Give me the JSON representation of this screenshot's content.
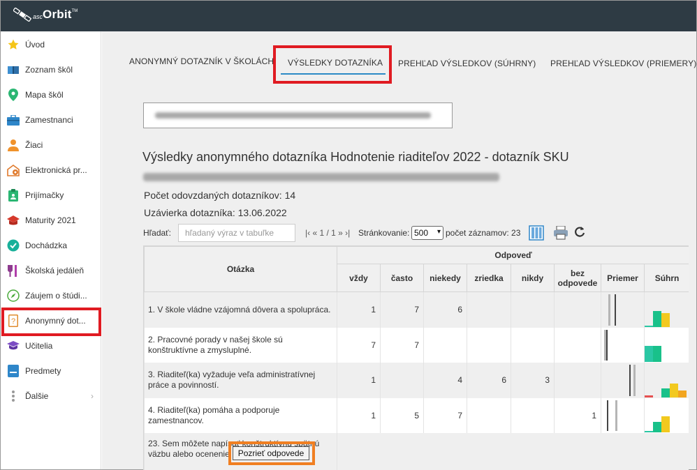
{
  "app": {
    "logo_small": "asc",
    "logo_big": "Orbit",
    "logo_tm": "TM"
  },
  "sidebar": {
    "items": [
      {
        "label": "Úvod",
        "icon": "star-icon"
      },
      {
        "label": "Zoznam škôl",
        "icon": "book-icon"
      },
      {
        "label": "Mapa škôl",
        "icon": "map-pin-icon"
      },
      {
        "label": "Zamestnanci",
        "icon": "briefcase-icon"
      },
      {
        "label": "Žiaci",
        "icon": "student-icon"
      },
      {
        "label": "Elektronická pr...",
        "icon": "building-icon"
      },
      {
        "label": "Prijímačky",
        "icon": "clipboard-icon"
      },
      {
        "label": "Maturity 2021",
        "icon": "graduation-cap-icon"
      },
      {
        "label": "Dochádzka",
        "icon": "check-badge-icon"
      },
      {
        "label": "Školská jedáleň",
        "icon": "cutlery-icon"
      },
      {
        "label": "Záujem o štúdi...",
        "icon": "compass-icon"
      },
      {
        "label": "Anonymný dot...",
        "icon": "question-doc-icon"
      },
      {
        "label": "Učitelia",
        "icon": "teacher-icon"
      },
      {
        "label": "Predmety",
        "icon": "subject-icon"
      },
      {
        "label": "Ďalšie",
        "icon": "more-dots-icon"
      }
    ]
  },
  "tabs": [
    {
      "label": "ANONYMNÝ DOTAZNÍK V ŠKOLÁCH"
    },
    {
      "label": "VÝSLEDKY DOTAZNÍKA"
    },
    {
      "label": "PREHĽAD VÝSLEDKOV (SÚHRNY)"
    },
    {
      "label": "PREHĽAD VÝSLEDKOV (PRIEMERY)"
    }
  ],
  "survey": {
    "title": "Výsledky anonymného dotazníka Hodnotenie riaditeľov 2022 - dotazník SKU",
    "submitted": "Počet odovzdaných dotazníkov: 14",
    "deadline": "Uzávierka dotazníka: 13.06.2022"
  },
  "toolbar": {
    "search_label": "Hľadať:",
    "search_placeholder": "hľadaný výraz v tabuľke",
    "pager": "|‹ « 1 / 1 » ›|",
    "paging_label": "Stránkovanie:",
    "page_size": "500",
    "records": "počet záznamov: 23"
  },
  "table": {
    "group_header": "Odpoveď",
    "question_header": "Otázka",
    "columns": [
      "vždy",
      "často",
      "niekedy",
      "zriedka",
      "nikdy",
      "bez odpovede"
    ],
    "avg_header": "Priemer",
    "sum_header": "Súhrn",
    "rows": [
      {
        "question": "1. V škole vládne vzájomná dôvera a spolupráca.",
        "cells": [
          "1",
          "7",
          "6",
          "",
          "",
          ""
        ]
      },
      {
        "question": "2. Pracovné porady v našej škole sú konštruktívne a zmysluplné.",
        "cells": [
          "7",
          "7",
          "",
          "",
          "",
          ""
        ]
      },
      {
        "question": "3. Riaditeľ(ka) vyžaduje veľa administratívnej práce a povinností.",
        "cells": [
          "1",
          "",
          "4",
          "6",
          "3",
          ""
        ]
      },
      {
        "question": "4. Riaditeľ(ka) pomáha a podporuje zamestnancov.",
        "cells": [
          "1",
          "5",
          "7",
          "",
          "",
          "1"
        ]
      },
      {
        "question": "23. Sem môžete napísať konštruktívnu spätnú väzbu alebo ocenenie:",
        "cells": []
      }
    ],
    "answers_button": "Pozrieť odpovede"
  },
  "colors": {
    "accent": "#2b8ac6",
    "highlight_red": "#e01b22",
    "highlight_orange": "#f07f22",
    "topbar": "#2e3b44"
  }
}
